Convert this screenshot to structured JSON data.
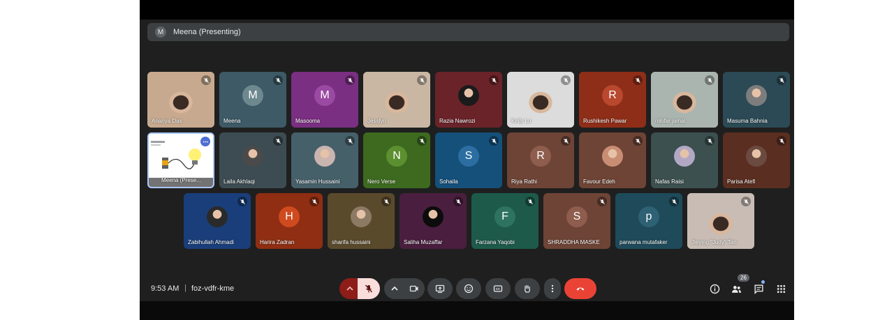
{
  "presenting_bar": {
    "avatar_letter": "M",
    "text": "Meena (Presenting)"
  },
  "tiles": [
    {
      "name": "Ananya Das",
      "type": "video",
      "bg": "#c7a98f"
    },
    {
      "name": "Meena",
      "type": "letter",
      "letter": "M",
      "bg": "#3d5a66",
      "avatar_bg": "#6e8890"
    },
    {
      "name": "Masooma",
      "type": "letter",
      "letter": "M",
      "bg": "#7a2f82",
      "avatar_bg": "#9b4aa3"
    },
    {
      "name": "Jesslyn",
      "type": "video",
      "bg": "#c9b7a3"
    },
    {
      "name": "Razia Nawrozi",
      "type": "pic",
      "bg": "#6a2329",
      "avatar_bg": "#1b1b1b"
    },
    {
      "name": "Kelly Lu",
      "type": "video",
      "bg": "#dcdcdc"
    },
    {
      "name": "Rushikesh Pawar",
      "type": "letter",
      "letter": "R",
      "bg": "#8f2e18",
      "avatar_bg": "#b8482e"
    },
    {
      "name": "nilofar jamal",
      "type": "video",
      "bg": "#aab5b0"
    },
    {
      "name": "Masuma Bahnia",
      "type": "pic",
      "bg": "#2b4a55",
      "avatar_bg": "#7d7d7d"
    },
    {
      "name": "Meena (Prese...",
      "type": "screen",
      "bg": "#ffffff"
    },
    {
      "name": "Laila Akhlaqi",
      "type": "pic",
      "bg": "#3c4c52",
      "avatar_bg": "#4a4a4a"
    },
    {
      "name": "Yasamin Hussaini",
      "type": "pic",
      "bg": "#46606a",
      "avatar_bg": "#c9b4b0"
    },
    {
      "name": "Nero Verse",
      "type": "letter",
      "letter": "N",
      "bg": "#3d6a1f",
      "avatar_bg": "#5c8f2f"
    },
    {
      "name": "Sohaila",
      "type": "letter",
      "letter": "S",
      "bg": "#14507a",
      "avatar_bg": "#2c6ea1"
    },
    {
      "name": "Riya Rathi",
      "type": "letter",
      "letter": "R",
      "bg": "#6e4436",
      "avatar_bg": "#8e5d4d"
    },
    {
      "name": "Favour Edeh",
      "type": "pic",
      "bg": "#6e4436",
      "avatar_bg": "#c98d74"
    },
    {
      "name": "Nafas Raisi",
      "type": "pic",
      "bg": "#3c5050",
      "avatar_bg": "#b2a8c4"
    },
    {
      "name": "Parisa Atefi",
      "type": "pic",
      "bg": "#5a2e21",
      "avatar_bg": "#6b4a40"
    },
    {
      "name": "Zabihullah Ahmadi",
      "type": "pic",
      "bg": "#1a3e7a",
      "avatar_bg": "#2a2a2a"
    },
    {
      "name": "Harira Zadran",
      "type": "letter",
      "letter": "H",
      "bg": "#8f2e12",
      "avatar_bg": "#d04a1f"
    },
    {
      "name": "sharifa hussaini",
      "type": "pic",
      "bg": "#5a4a2c",
      "avatar_bg": "#8c7a64"
    },
    {
      "name": "Saliha Muzaffar",
      "type": "pic",
      "bg": "#4a1e3e",
      "avatar_bg": "#0c0c0c"
    },
    {
      "name": "Farzana Yaqobi",
      "type": "letter",
      "letter": "F",
      "bg": "#1d5a4a",
      "avatar_bg": "#2e7360"
    },
    {
      "name": "SHRADDHA MASKE",
      "type": "letter",
      "letter": "S",
      "bg": "#6e4436",
      "avatar_bg": "#8e5d4d"
    },
    {
      "name": "parwana mutafaker",
      "type": "letter",
      "letter": "p",
      "bg": "#1e4a5a",
      "avatar_bg": "#2e6173"
    },
    {
      "name": "Jieying \"Judy\" Tan",
      "type": "video",
      "bg": "#c8bcb4"
    }
  ],
  "controls": {
    "time": "9:53 AM",
    "separator": "|",
    "meeting_code": "foz-vdfr-kme",
    "participant_count": "26"
  },
  "colors": {
    "background": "#1f1f1f",
    "control_bg": "#3c4043",
    "end_call": "#ea4335",
    "mic_off_bg": "#f9dedc",
    "mic_off_group": "#8c1d18"
  },
  "icons": [
    "chevron-up-icon",
    "mic-off-icon",
    "camera-icon",
    "present-icon",
    "emoji-icon",
    "captions-icon",
    "raise-hand-icon",
    "more-options-icon",
    "end-call-icon",
    "info-icon",
    "people-icon",
    "chat-icon",
    "activities-icon"
  ]
}
